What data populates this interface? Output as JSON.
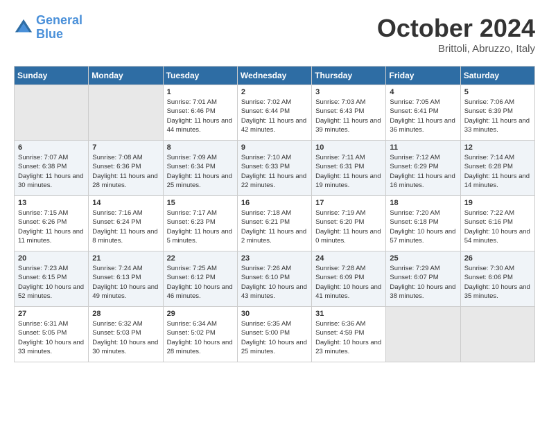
{
  "header": {
    "logo_line1": "General",
    "logo_line2": "Blue",
    "month_title": "October 2024",
    "subtitle": "Brittoli, Abruzzo, Italy"
  },
  "days_of_week": [
    "Sunday",
    "Monday",
    "Tuesday",
    "Wednesday",
    "Thursday",
    "Friday",
    "Saturday"
  ],
  "weeks": [
    [
      {
        "num": "",
        "sunrise": "",
        "sunset": "",
        "daylight": ""
      },
      {
        "num": "",
        "sunrise": "",
        "sunset": "",
        "daylight": ""
      },
      {
        "num": "1",
        "sunrise": "Sunrise: 7:01 AM",
        "sunset": "Sunset: 6:46 PM",
        "daylight": "Daylight: 11 hours and 44 minutes."
      },
      {
        "num": "2",
        "sunrise": "Sunrise: 7:02 AM",
        "sunset": "Sunset: 6:44 PM",
        "daylight": "Daylight: 11 hours and 42 minutes."
      },
      {
        "num": "3",
        "sunrise": "Sunrise: 7:03 AM",
        "sunset": "Sunset: 6:43 PM",
        "daylight": "Daylight: 11 hours and 39 minutes."
      },
      {
        "num": "4",
        "sunrise": "Sunrise: 7:05 AM",
        "sunset": "Sunset: 6:41 PM",
        "daylight": "Daylight: 11 hours and 36 minutes."
      },
      {
        "num": "5",
        "sunrise": "Sunrise: 7:06 AM",
        "sunset": "Sunset: 6:39 PM",
        "daylight": "Daylight: 11 hours and 33 minutes."
      }
    ],
    [
      {
        "num": "6",
        "sunrise": "Sunrise: 7:07 AM",
        "sunset": "Sunset: 6:38 PM",
        "daylight": "Daylight: 11 hours and 30 minutes."
      },
      {
        "num": "7",
        "sunrise": "Sunrise: 7:08 AM",
        "sunset": "Sunset: 6:36 PM",
        "daylight": "Daylight: 11 hours and 28 minutes."
      },
      {
        "num": "8",
        "sunrise": "Sunrise: 7:09 AM",
        "sunset": "Sunset: 6:34 PM",
        "daylight": "Daylight: 11 hours and 25 minutes."
      },
      {
        "num": "9",
        "sunrise": "Sunrise: 7:10 AM",
        "sunset": "Sunset: 6:33 PM",
        "daylight": "Daylight: 11 hours and 22 minutes."
      },
      {
        "num": "10",
        "sunrise": "Sunrise: 7:11 AM",
        "sunset": "Sunset: 6:31 PM",
        "daylight": "Daylight: 11 hours and 19 minutes."
      },
      {
        "num": "11",
        "sunrise": "Sunrise: 7:12 AM",
        "sunset": "Sunset: 6:29 PM",
        "daylight": "Daylight: 11 hours and 16 minutes."
      },
      {
        "num": "12",
        "sunrise": "Sunrise: 7:14 AM",
        "sunset": "Sunset: 6:28 PM",
        "daylight": "Daylight: 11 hours and 14 minutes."
      }
    ],
    [
      {
        "num": "13",
        "sunrise": "Sunrise: 7:15 AM",
        "sunset": "Sunset: 6:26 PM",
        "daylight": "Daylight: 11 hours and 11 minutes."
      },
      {
        "num": "14",
        "sunrise": "Sunrise: 7:16 AM",
        "sunset": "Sunset: 6:24 PM",
        "daylight": "Daylight: 11 hours and 8 minutes."
      },
      {
        "num": "15",
        "sunrise": "Sunrise: 7:17 AM",
        "sunset": "Sunset: 6:23 PM",
        "daylight": "Daylight: 11 hours and 5 minutes."
      },
      {
        "num": "16",
        "sunrise": "Sunrise: 7:18 AM",
        "sunset": "Sunset: 6:21 PM",
        "daylight": "Daylight: 11 hours and 2 minutes."
      },
      {
        "num": "17",
        "sunrise": "Sunrise: 7:19 AM",
        "sunset": "Sunset: 6:20 PM",
        "daylight": "Daylight: 11 hours and 0 minutes."
      },
      {
        "num": "18",
        "sunrise": "Sunrise: 7:20 AM",
        "sunset": "Sunset: 6:18 PM",
        "daylight": "Daylight: 10 hours and 57 minutes."
      },
      {
        "num": "19",
        "sunrise": "Sunrise: 7:22 AM",
        "sunset": "Sunset: 6:16 PM",
        "daylight": "Daylight: 10 hours and 54 minutes."
      }
    ],
    [
      {
        "num": "20",
        "sunrise": "Sunrise: 7:23 AM",
        "sunset": "Sunset: 6:15 PM",
        "daylight": "Daylight: 10 hours and 52 minutes."
      },
      {
        "num": "21",
        "sunrise": "Sunrise: 7:24 AM",
        "sunset": "Sunset: 6:13 PM",
        "daylight": "Daylight: 10 hours and 49 minutes."
      },
      {
        "num": "22",
        "sunrise": "Sunrise: 7:25 AM",
        "sunset": "Sunset: 6:12 PM",
        "daylight": "Daylight: 10 hours and 46 minutes."
      },
      {
        "num": "23",
        "sunrise": "Sunrise: 7:26 AM",
        "sunset": "Sunset: 6:10 PM",
        "daylight": "Daylight: 10 hours and 43 minutes."
      },
      {
        "num": "24",
        "sunrise": "Sunrise: 7:28 AM",
        "sunset": "Sunset: 6:09 PM",
        "daylight": "Daylight: 10 hours and 41 minutes."
      },
      {
        "num": "25",
        "sunrise": "Sunrise: 7:29 AM",
        "sunset": "Sunset: 6:07 PM",
        "daylight": "Daylight: 10 hours and 38 minutes."
      },
      {
        "num": "26",
        "sunrise": "Sunrise: 7:30 AM",
        "sunset": "Sunset: 6:06 PM",
        "daylight": "Daylight: 10 hours and 35 minutes."
      }
    ],
    [
      {
        "num": "27",
        "sunrise": "Sunrise: 6:31 AM",
        "sunset": "Sunset: 5:05 PM",
        "daylight": "Daylight: 10 hours and 33 minutes."
      },
      {
        "num": "28",
        "sunrise": "Sunrise: 6:32 AM",
        "sunset": "Sunset: 5:03 PM",
        "daylight": "Daylight: 10 hours and 30 minutes."
      },
      {
        "num": "29",
        "sunrise": "Sunrise: 6:34 AM",
        "sunset": "Sunset: 5:02 PM",
        "daylight": "Daylight: 10 hours and 28 minutes."
      },
      {
        "num": "30",
        "sunrise": "Sunrise: 6:35 AM",
        "sunset": "Sunset: 5:00 PM",
        "daylight": "Daylight: 10 hours and 25 minutes."
      },
      {
        "num": "31",
        "sunrise": "Sunrise: 6:36 AM",
        "sunset": "Sunset: 4:59 PM",
        "daylight": "Daylight: 10 hours and 23 minutes."
      },
      {
        "num": "",
        "sunrise": "",
        "sunset": "",
        "daylight": ""
      },
      {
        "num": "",
        "sunrise": "",
        "sunset": "",
        "daylight": ""
      }
    ]
  ]
}
